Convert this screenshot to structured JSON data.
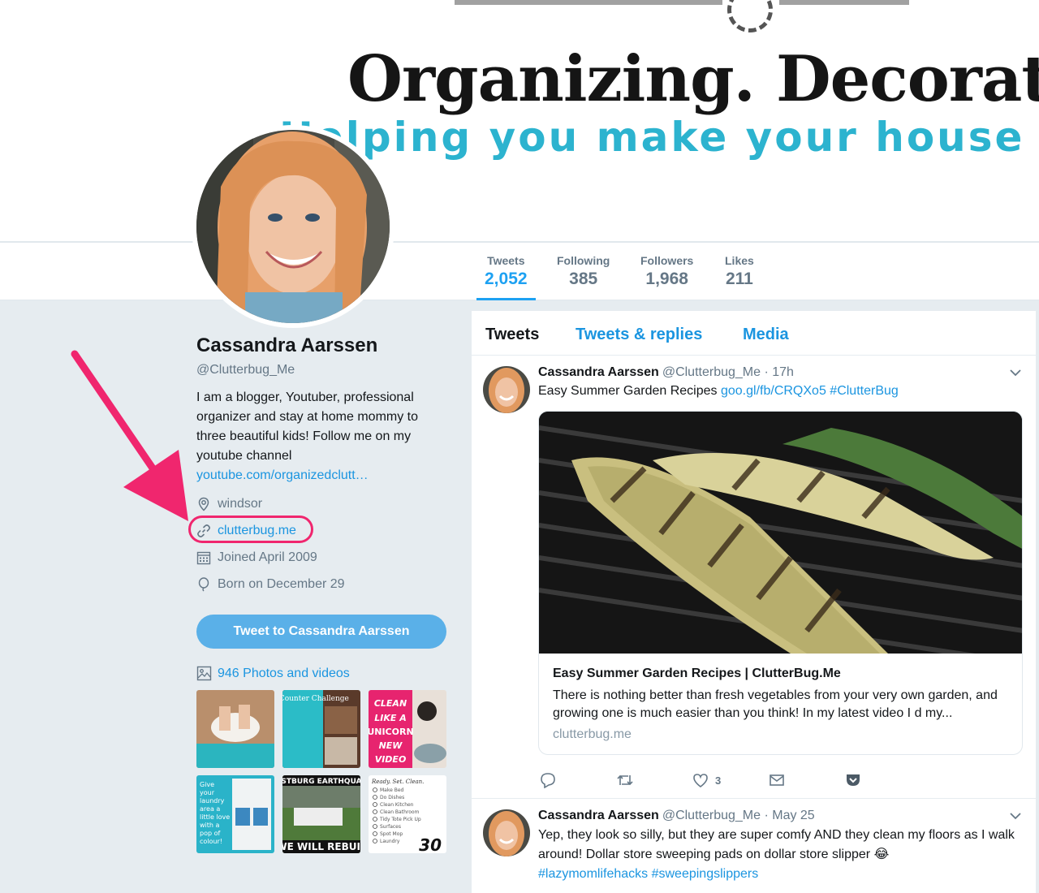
{
  "banner": {
    "headline": "Organizing. Decorati",
    "tagline": "Helping you make your house a hon"
  },
  "nav": {
    "stats": [
      {
        "label": "Tweets",
        "value": "2,052",
        "active": true
      },
      {
        "label": "Following",
        "value": "385",
        "active": false
      },
      {
        "label": "Followers",
        "value": "1,968",
        "active": false
      },
      {
        "label": "Likes",
        "value": "211",
        "active": false
      }
    ]
  },
  "profile": {
    "name": "Cassandra Aarssen",
    "handle": "@Clutterbug_Me",
    "bio": "I am a blogger, Youtuber, professional organizer and stay at home mommy to three beautiful kids! Follow me on my youtube channel",
    "bio_link": "youtube.com/organizedclutt…",
    "location": "windsor",
    "website": "clutterbug.me",
    "joined": "Joined April 2009",
    "born": "Born on December 29",
    "tweet_to_label": "Tweet to Cassandra Aarssen",
    "photos_label": "946 Photos and videos"
  },
  "thumbnails": [
    {
      "name": "slipper-mop",
      "text": ""
    },
    {
      "name": "clear-counter",
      "text": "Clear Counter Challenge"
    },
    {
      "name": "clean-unicorn",
      "text": "CLEAN LIKE A UNICORN NEW VIDEO"
    },
    {
      "name": "laundry",
      "text": "Give your laundry area a little love with a pop of colour!"
    },
    {
      "name": "earthquake",
      "text": "WE WILL REBUIL"
    },
    {
      "name": "checklist",
      "text": "30"
    }
  ],
  "timeline": {
    "tabs": [
      {
        "label": "Tweets",
        "active": true
      },
      {
        "label": "Tweets & replies",
        "active": false
      },
      {
        "label": "Media",
        "active": false
      }
    ],
    "tweets": [
      {
        "name": "Cassandra Aarssen",
        "handle": "@Clutterbug_Me · 17h",
        "text": "Easy Summer Garden Recipes",
        "link1": "goo.gl/fb/CRQXo5",
        "link2": "#ClutterBug",
        "card_title": "Easy Summer Garden Recipes | ClutterBug.Me",
        "card_desc": "There is nothing better than fresh vegetables from your very own garden, and growing one is much easier than you think! In my latest video I d my...",
        "card_domain": "clutterbug.me",
        "likes": "3"
      },
      {
        "name": "Cassandra Aarssen",
        "handle": "@Clutterbug_Me · May 25",
        "text": "Yep, they look so silly, but they are super comfy AND they clean my floors as I walk around! Dollar store sweeping pads on dollar store slipper 😂",
        "hashtags": "#lazymomlifehacks #sweepingslippers"
      }
    ]
  },
  "colors": {
    "accent": "#1da1f2",
    "link": "#1b95e0",
    "highlight": "#f0266e",
    "tagline": "#2cb3cf"
  }
}
